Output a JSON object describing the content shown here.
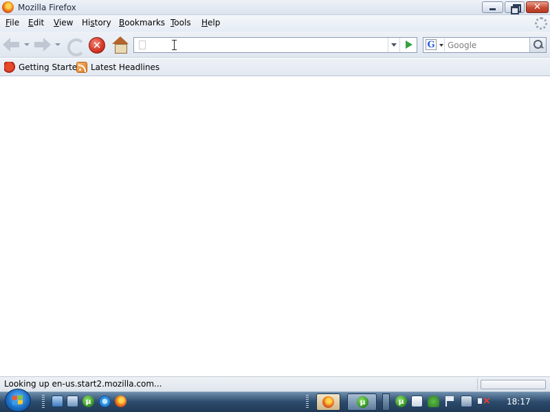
{
  "window": {
    "title": "Mozilla Firefox",
    "close_glyph": "✕"
  },
  "menu": {
    "items": [
      {
        "label": "File",
        "accel": "F",
        "rest": "ile"
      },
      {
        "label": "Edit",
        "accel": "E",
        "rest": "dit"
      },
      {
        "label": "View",
        "accel": "V",
        "rest": "iew"
      },
      {
        "label": "History",
        "accel": "s",
        "pre": "Hi",
        "rest": "tory"
      },
      {
        "label": "Bookmarks",
        "accel": "B",
        "rest": "ookmarks"
      },
      {
        "label": "Tools",
        "accel": "T",
        "rest": "ools"
      },
      {
        "label": "Help",
        "accel": "H",
        "rest": "elp"
      }
    ]
  },
  "navigation": {
    "stop_glyph": "✕",
    "url": {
      "value": "",
      "placeholder": ""
    },
    "search": {
      "engine": "Google",
      "engine_glyph": "G",
      "placeholder": "Google",
      "value": ""
    }
  },
  "bookmarks": {
    "items": [
      {
        "label": "Getting Started",
        "icon": "firefox-bookmark-icon"
      },
      {
        "label": "Latest Headlines",
        "icon": "rss-feed-icon"
      }
    ]
  },
  "status": {
    "text": "Looking up en-us.start2.mozilla.com...",
    "progress": 0
  },
  "taskbar": {
    "quick_launch": [
      "show-desktop-icon",
      "switch-windows-icon",
      "utorrent-icon",
      "internet-explorer-icon",
      "firefox-icon"
    ],
    "tasks": [
      "Mozilla Firefox",
      "uTorrent"
    ],
    "tray": [
      "utorrent-icon",
      "notes-icon",
      "security-icon",
      "action-center-flag-icon",
      "network-icon",
      "volume-muted-icon"
    ],
    "utorrent_glyph": "µ",
    "clock": "18:17"
  }
}
